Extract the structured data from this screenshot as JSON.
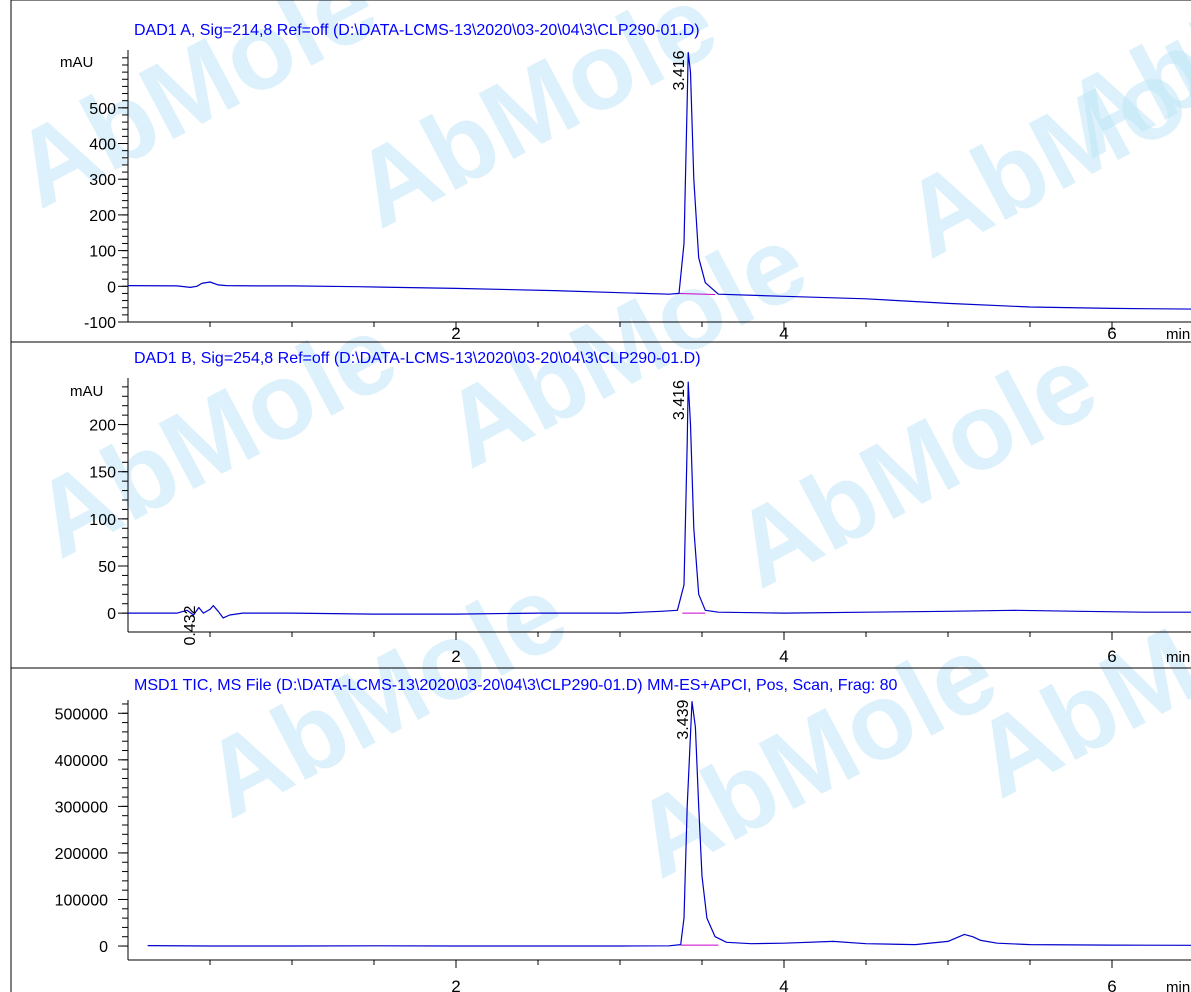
{
  "watermark": {
    "text": "AbMole",
    "color": "#bfe6f7",
    "dot_color": "#fde7a6"
  },
  "colors": {
    "trace": "#0000cc",
    "title": "#0000ff",
    "baseline": "#cc00cc",
    "axis": "#000000"
  },
  "chart_data": [
    {
      "type": "line",
      "title": "DAD1 A, Sig=214,8 Ref=off (D:\\DATA-LCMS-13\\2020\\03-20\\04\\3\\CLP290-01.D)",
      "ylabel": "mAU",
      "xlabel": "min",
      "x_ticks": [
        "2",
        "4",
        "6"
      ],
      "y_ticks": [
        "-100",
        "0",
        "100",
        "200",
        "300",
        "400",
        "500"
      ],
      "xlim": [
        0,
        7.3
      ],
      "ylim": [
        -100,
        690
      ],
      "peak_labels": [
        {
          "rt": "3.416",
          "x": 3.416,
          "y": 655
        }
      ],
      "series": [
        {
          "x": [
            0.0,
            0.3,
            0.38,
            0.42,
            0.45,
            0.5,
            0.55,
            0.6,
            0.8,
            1.0,
            1.4,
            2.0,
            2.6,
            3.0,
            3.3,
            3.36,
            3.39,
            3.41,
            3.416,
            3.43,
            3.45,
            3.48,
            3.52,
            3.6,
            4.0,
            4.5,
            5.0,
            5.5,
            6.0,
            6.5,
            7.0,
            7.3
          ],
          "y": [
            2,
            1,
            -3,
            0,
            8,
            12,
            4,
            2,
            1,
            1,
            -1,
            -6,
            -12,
            -18,
            -22,
            -20,
            120,
            520,
            655,
            600,
            300,
            80,
            10,
            -22,
            -28,
            -35,
            -48,
            -58,
            -62,
            -64,
            -65,
            -65
          ]
        }
      ],
      "baseline_segments": [
        {
          "x": [
            3.36,
            3.58
          ],
          "y": [
            -20,
            -23
          ]
        }
      ]
    },
    {
      "type": "line",
      "title": "DAD1 B, Sig=254,8 Ref=off (D:\\DATA-LCMS-13\\2020\\03-20\\04\\3\\CLP290-01.D)",
      "ylabel": "mAU",
      "xlabel": "min",
      "x_ticks": [
        "2",
        "4",
        "6"
      ],
      "y_ticks": [
        "0",
        "50",
        "100",
        "150",
        "200"
      ],
      "xlim": [
        0,
        7.3
      ],
      "ylim": [
        -20,
        260
      ],
      "peak_labels": [
        {
          "rt": "0.432",
          "x": 0.432,
          "y": 6
        },
        {
          "rt": "3.416",
          "x": 3.416,
          "y": 245
        }
      ],
      "series": [
        {
          "x": [
            0.0,
            0.3,
            0.36,
            0.4,
            0.432,
            0.46,
            0.5,
            0.52,
            0.55,
            0.58,
            0.62,
            0.7,
            1.0,
            1.5,
            2.0,
            2.5,
            3.0,
            3.25,
            3.35,
            3.39,
            3.41,
            3.416,
            3.43,
            3.45,
            3.48,
            3.52,
            3.6,
            4.0,
            4.5,
            5.0,
            5.4,
            5.8,
            6.2,
            7.3
          ],
          "y": [
            0,
            0,
            3,
            -2,
            6,
            0,
            4,
            8,
            2,
            -5,
            -2,
            0,
            0,
            -1,
            -1,
            0,
            0,
            2,
            3,
            30,
            180,
            245,
            200,
            90,
            20,
            3,
            1,
            0,
            1,
            2,
            3,
            2,
            1,
            1
          ]
        }
      ],
      "baseline_segments": [
        {
          "x": [
            3.38,
            3.52
          ],
          "y": [
            0,
            0
          ]
        }
      ]
    },
    {
      "type": "line",
      "title": "MSD1 TIC, MS File (D:\\DATA-LCMS-13\\2020\\03-20\\04\\3\\CLP290-01.D)    MM-ES+APCI, Pos, Scan, Frag: 80",
      "ylabel": "",
      "xlabel": "min",
      "x_ticks": [
        "2",
        "4",
        "6"
      ],
      "y_ticks": [
        "0",
        "100000",
        "200000",
        "300000",
        "400000",
        "500000"
      ],
      "xlim": [
        0,
        7.3
      ],
      "ylim": [
        -30000,
        550000
      ],
      "peak_labels": [
        {
          "rt": "3.439",
          "x": 3.439,
          "y": 525000
        }
      ],
      "series": [
        {
          "x": [
            0.12,
            0.5,
            1.0,
            1.5,
            2.0,
            2.5,
            3.0,
            3.3,
            3.37,
            3.39,
            3.41,
            3.439,
            3.46,
            3.48,
            3.5,
            3.53,
            3.58,
            3.65,
            3.8,
            4.0,
            4.3,
            4.5,
            4.8,
            5.0,
            5.1,
            5.15,
            5.2,
            5.3,
            5.5,
            6.0,
            6.5,
            7.3
          ],
          "y": [
            1000,
            0,
            0,
            500,
            0,
            0,
            0,
            500,
            3000,
            60000,
            300000,
            525000,
            470000,
            300000,
            150000,
            60000,
            20000,
            8000,
            5000,
            6000,
            10000,
            5000,
            3000,
            10000,
            25000,
            20000,
            12000,
            6000,
            3000,
            2000,
            1500,
            1500
          ]
        }
      ],
      "baseline_segments": [
        {
          "x": [
            3.37,
            3.6
          ],
          "y": [
            2000,
            2000
          ]
        }
      ]
    }
  ]
}
